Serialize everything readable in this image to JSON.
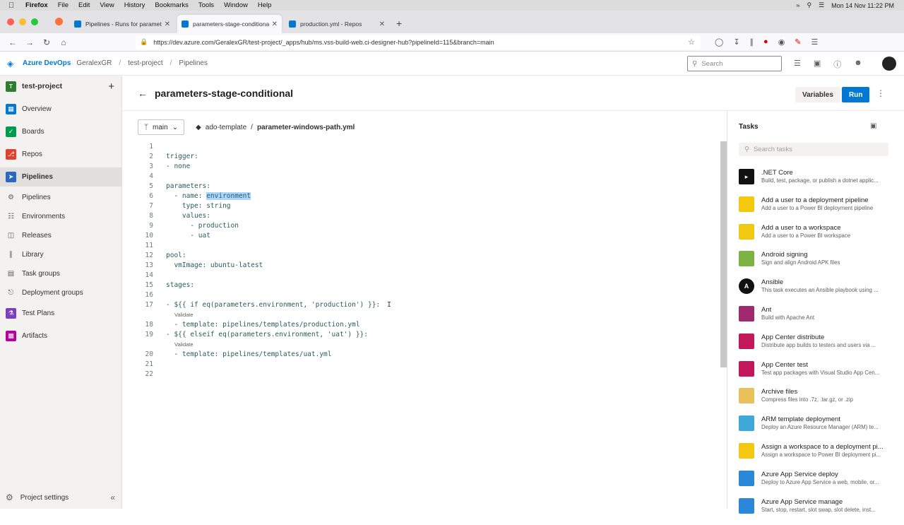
{
  "menubar": {
    "app": "Firefox",
    "items": [
      "File",
      "Edit",
      "View",
      "History",
      "Bookmarks",
      "Tools",
      "Window",
      "Help"
    ],
    "clock": "Mon 14 Nov  11:22 PM"
  },
  "browser": {
    "tabs": [
      {
        "label": "Pipelines - Runs for parameters",
        "active": false
      },
      {
        "label": "parameters-stage-conditional -",
        "active": true
      },
      {
        "label": "production.yml - Repos",
        "active": false
      }
    ],
    "url": "https://dev.azure.com/GeralexGR/test-project/_apps/hub/ms.vss-build-web.ci-designer-hub?pipelineId=115&branch=main"
  },
  "topbar": {
    "brand": "Azure DevOps",
    "org": "GeralexGR",
    "project": "test-project",
    "section": "Pipelines",
    "search_placeholder": "Search"
  },
  "leftnav": {
    "project": "test-project",
    "project_initial": "T",
    "items": [
      {
        "label": "Overview"
      },
      {
        "label": "Boards"
      },
      {
        "label": "Repos"
      },
      {
        "label": "Pipelines"
      },
      {
        "label": "Pipelines"
      },
      {
        "label": "Environments"
      },
      {
        "label": "Releases"
      },
      {
        "label": "Library"
      },
      {
        "label": "Task groups"
      },
      {
        "label": "Deployment groups"
      },
      {
        "label": "Test Plans"
      },
      {
        "label": "Artifacts"
      }
    ],
    "settings": "Project settings"
  },
  "page": {
    "title": "parameters-stage-conditional",
    "variables_label": "Variables",
    "run_label": "Run",
    "branch": "main",
    "repo": "ado-template",
    "path_sep": "/",
    "file": "parameter-windows-path.yml"
  },
  "editor": {
    "validate_label": "Validate",
    "lines": [
      {
        "n": "1",
        "text": ""
      },
      {
        "n": "2",
        "text": "trigger:"
      },
      {
        "n": "3",
        "text": "- none"
      },
      {
        "n": "4",
        "text": ""
      },
      {
        "n": "5",
        "text": "parameters:"
      },
      {
        "n": "6",
        "text": "  - name: ",
        "hl": "environment"
      },
      {
        "n": "7",
        "text": "    type: string"
      },
      {
        "n": "8",
        "text": "    values:"
      },
      {
        "n": "9",
        "text": "      - production"
      },
      {
        "n": "10",
        "text": "      - uat"
      },
      {
        "n": "11",
        "text": ""
      },
      {
        "n": "12",
        "text": "pool:"
      },
      {
        "n": "13",
        "text": "  vmImage: ubuntu-latest"
      },
      {
        "n": "14",
        "text": ""
      },
      {
        "n": "15",
        "text": "stages:"
      },
      {
        "n": "16",
        "text": ""
      },
      {
        "n": "17",
        "text": "- ${{ if eq(parameters.environment, 'production') }}:"
      },
      {
        "n": "18",
        "text": "  - template: pipelines/templates/production.yml"
      },
      {
        "n": "19",
        "text": "- ${{ elseif eq(parameters.environment, 'uat') }}:"
      },
      {
        "n": "20",
        "text": "  - template: pipelines/templates/uat.yml"
      },
      {
        "n": "21",
        "text": ""
      },
      {
        "n": "22",
        "text": ""
      }
    ]
  },
  "tasks": {
    "title": "Tasks",
    "search_placeholder": "Search tasks",
    "items": [
      {
        "name": ".NET Core",
        "desc": "Build, test, package, or publish a dotnet applic...",
        "icon": "dotnet-icon",
        "color": "#111111",
        "glyph": "dotnet"
      },
      {
        "name": "Add a user to a deployment pipeline",
        "desc": "Add a user to a Power BI deployment pipeline",
        "icon": "powerbi-icon",
        "color": "#f2c811",
        "glyph": ""
      },
      {
        "name": "Add a user to a workspace",
        "desc": "Add a user to a Power BI workspace",
        "icon": "powerbi-icon",
        "color": "#f2c811",
        "glyph": ""
      },
      {
        "name": "Android signing",
        "desc": "Sign and align Android APK files",
        "icon": "android-icon",
        "color": "#7cb342",
        "glyph": ""
      },
      {
        "name": "Ansible",
        "desc": "This task executes an Ansible playbook using ...",
        "icon": "ansible-icon",
        "color": "#111111",
        "glyph": "A"
      },
      {
        "name": "Ant",
        "desc": "Build with Apache Ant",
        "icon": "ant-icon",
        "color": "#a02a6e",
        "glyph": ""
      },
      {
        "name": "App Center distribute",
        "desc": "Distribute app builds to testers and users via ...",
        "icon": "app-center-icon",
        "color": "#c2185b",
        "glyph": ""
      },
      {
        "name": "App Center test",
        "desc": "Test app packages with Visual Studio App Cen...",
        "icon": "app-center-icon",
        "color": "#c2185b",
        "glyph": ""
      },
      {
        "name": "Archive files",
        "desc": "Compress files into .7z, .tar.gz, or .zip",
        "icon": "archive-icon",
        "color": "#e8c15a",
        "glyph": ""
      },
      {
        "name": "ARM template deployment",
        "desc": "Deploy an Azure Resource Manager (ARM) te...",
        "icon": "arm-icon",
        "color": "#3ea8d8",
        "glyph": ""
      },
      {
        "name": "Assign a workspace to a deployment pi...",
        "desc": "Assign a workspace to Power BI deployment pi...",
        "icon": "powerbi-icon",
        "color": "#f2c811",
        "glyph": ""
      },
      {
        "name": "Azure App Service deploy",
        "desc": "Deploy to Azure App Service a web, mobile, or...",
        "icon": "app-service-icon",
        "color": "#2b88d8",
        "glyph": ""
      },
      {
        "name": "Azure App Service manage",
        "desc": "Start, stop, restart, slot swap, slot delete, inst...",
        "icon": "app-service-icon",
        "color": "#2b88d8",
        "glyph": ""
      }
    ]
  }
}
